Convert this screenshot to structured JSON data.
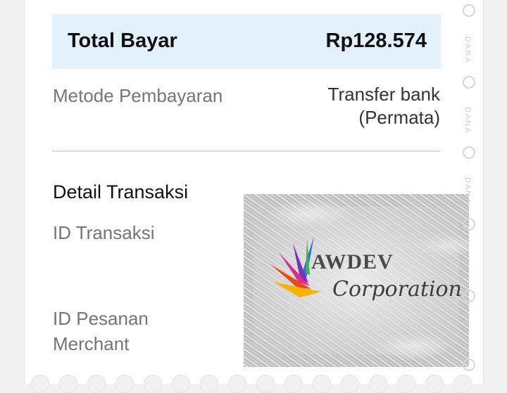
{
  "total": {
    "label": "Total Bayar",
    "amount": "Rp128.574"
  },
  "payment_method": {
    "label": "Metode Pembayaran",
    "value_line1": "Transfer bank",
    "value_line2": "(Permata)"
  },
  "transaction_detail": {
    "title": "Detail Transaksi",
    "transaction_id_label": "ID Transaksi",
    "merchant_order_id_label_line1": "ID Pesanan",
    "merchant_order_id_label_line2": "Merchant"
  },
  "overlay_logo": {
    "main_text": "AWDEV",
    "script_text": "Corporation"
  },
  "watermark": {
    "text": "DANA"
  },
  "colors": {
    "total_bar_bg": "#e3f1fc",
    "label_grey": "#757575",
    "text_dark": "#111111"
  }
}
